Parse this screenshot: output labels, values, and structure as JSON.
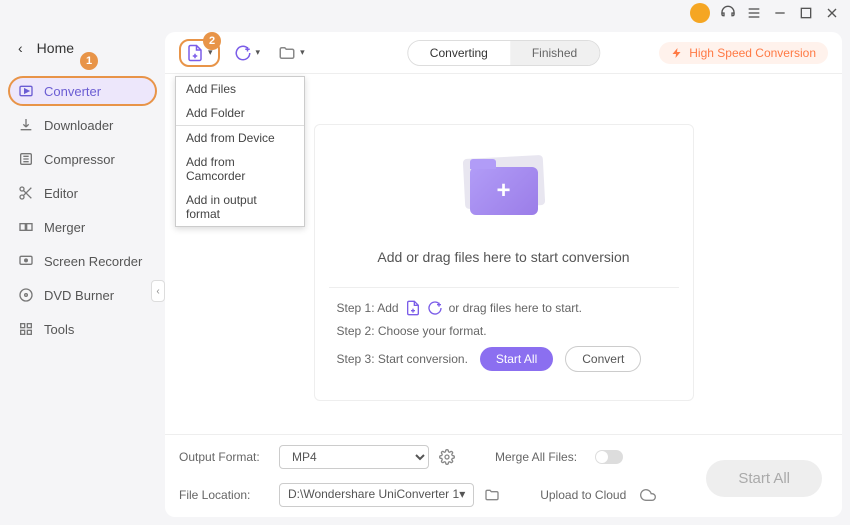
{
  "titlebar": {},
  "sidebar": {
    "home_label": "Home",
    "items": [
      {
        "label": "Converter"
      },
      {
        "label": "Downloader"
      },
      {
        "label": "Compressor"
      },
      {
        "label": "Editor"
      },
      {
        "label": "Merger"
      },
      {
        "label": "Screen Recorder"
      },
      {
        "label": "DVD Burner"
      },
      {
        "label": "Tools"
      }
    ]
  },
  "badges": {
    "b1": "1",
    "b2": "2"
  },
  "tabs": {
    "converting": "Converting",
    "finished": "Finished"
  },
  "speed_label": "High Speed Conversion",
  "dropdown": {
    "add_files": "Add Files",
    "add_folder": "Add Folder",
    "from_device": "Add from Device",
    "from_camcorder": "Add from Camcorder",
    "in_output": "Add in output format"
  },
  "drop_text": "Add or drag files here to start conversion",
  "steps": {
    "s1_prefix": "Step 1: Add",
    "s1_suffix": "or drag files here to start.",
    "s2": "Step 2: Choose your format.",
    "s3": "Step 3: Start conversion.",
    "start_all": "Start All",
    "convert": "Convert"
  },
  "footer": {
    "output_format_label": "Output Format:",
    "output_format_value": "MP4",
    "merge_label": "Merge All Files:",
    "location_label": "File Location:",
    "location_value": "D:\\Wondershare UniConverter 1",
    "upload_label": "Upload to Cloud",
    "start_all_btn": "Start All"
  }
}
